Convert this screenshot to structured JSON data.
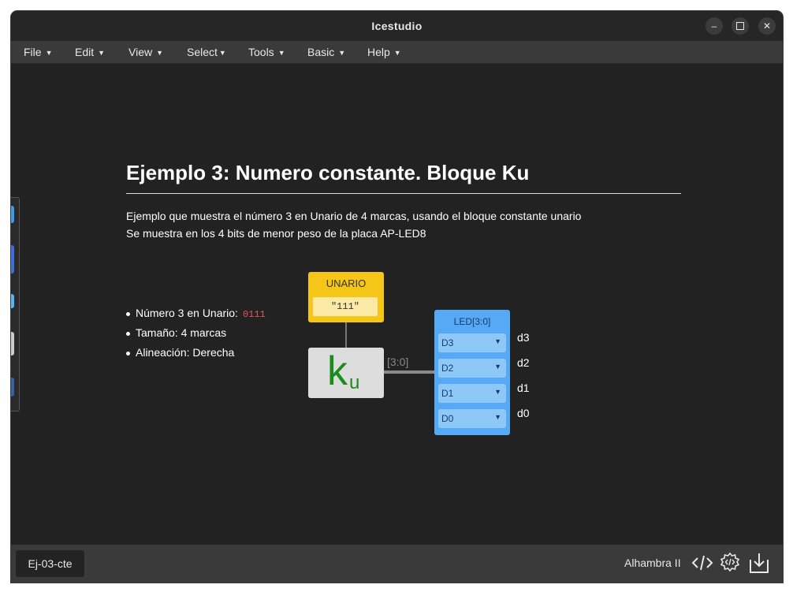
{
  "window": {
    "title": "Icestudio",
    "controls": [
      "minimize-icon",
      "maximize-icon",
      "close-icon"
    ]
  },
  "menu": [
    "File",
    "Edit",
    "View",
    "Select",
    "Tools",
    "Basic",
    "Help"
  ],
  "doc": {
    "heading": "Ejemplo 3: Numero constante. Bloque Ku",
    "desc1": "Ejemplo que muestra el número 3 en Unario de 4 marcas, usando el bloque constante unario",
    "desc2": "Se muestra en los 4 bits de menor peso de la placa AP-LED8",
    "bullets": [
      {
        "text": "Número 3 en Unario:",
        "code": "0111"
      },
      {
        "text": "Tamaño: 4 marcas"
      },
      {
        "text": "Alineación: Derecha"
      }
    ]
  },
  "circuit": {
    "unario": {
      "title": "UNARIO",
      "value": "\"111\""
    },
    "ku": {
      "symbol": "k",
      "subscript": "u"
    },
    "wire_label": "[3:0]",
    "led": {
      "title": "LED[3:0]",
      "rows": [
        "D3",
        "D2",
        "D1",
        "D0"
      ],
      "pins": [
        "d3",
        "d2",
        "d1",
        "d0"
      ]
    }
  },
  "footer": {
    "file": "Ej-03-cte",
    "board": "Alhambra II",
    "icons": [
      "code-icon",
      "gear-code-icon",
      "download-icon"
    ]
  },
  "colors": {
    "background": "#222222",
    "unario_block": "#f5c518",
    "led_block": "#56aaf5",
    "ku_glyph": "#1a8c1a",
    "code_text": "#e0555f"
  }
}
